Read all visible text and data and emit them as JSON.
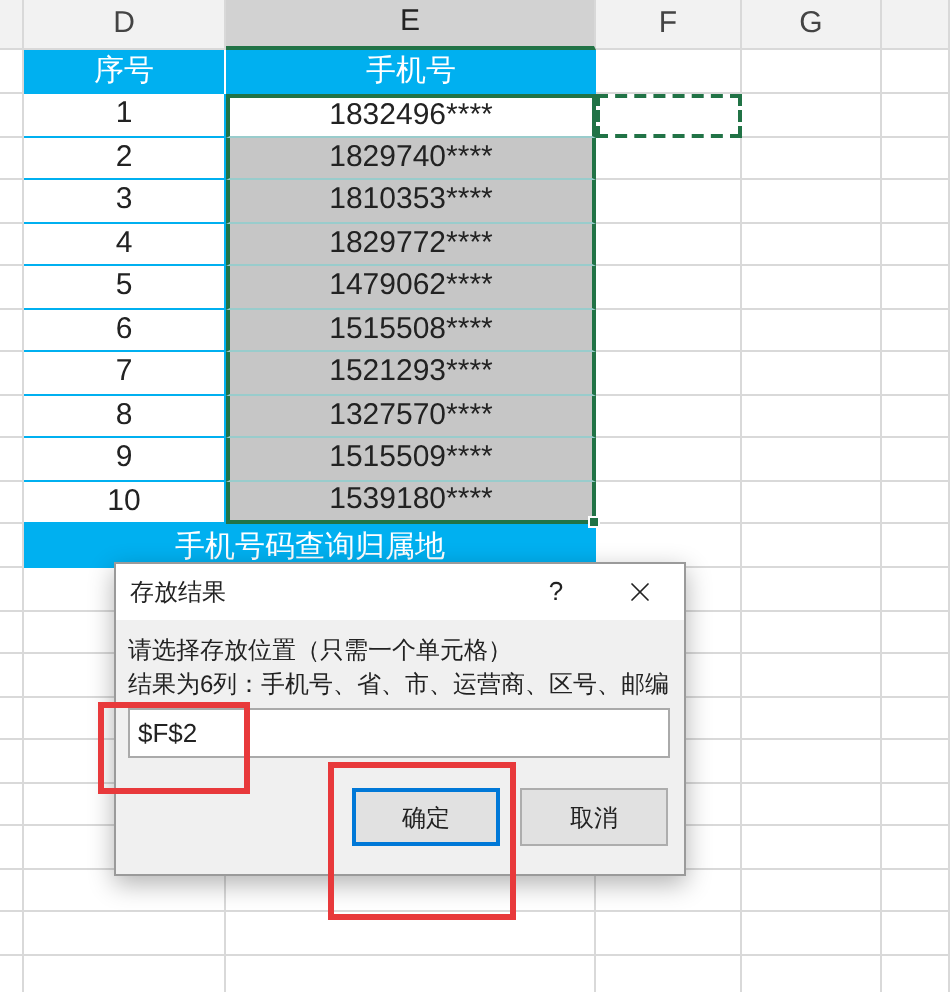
{
  "columns": [
    {
      "label": "D",
      "selected": false
    },
    {
      "label": "E",
      "selected": true
    },
    {
      "label": "F",
      "selected": false
    },
    {
      "label": "G",
      "selected": false
    }
  ],
  "table": {
    "headers": [
      "序号",
      "手机号"
    ],
    "rows": [
      {
        "index": "1",
        "phone": "1832496****",
        "highlighted": false
      },
      {
        "index": "2",
        "phone": "1829740****",
        "highlighted": true
      },
      {
        "index": "3",
        "phone": "1810353****",
        "highlighted": true
      },
      {
        "index": "4",
        "phone": "1829772****",
        "highlighted": true
      },
      {
        "index": "5",
        "phone": "1479062****",
        "highlighted": true
      },
      {
        "index": "6",
        "phone": "1515508****",
        "highlighted": true
      },
      {
        "index": "7",
        "phone": "1521293****",
        "highlighted": true
      },
      {
        "index": "8",
        "phone": "1327570****",
        "highlighted": true
      },
      {
        "index": "9",
        "phone": "1515509****",
        "highlighted": true
      },
      {
        "index": "10",
        "phone": "1539180****",
        "highlighted": true
      }
    ],
    "title": "手机号码查询归属地"
  },
  "dialog": {
    "title": "存放结果",
    "help": "?",
    "prompt": "请选择存放位置（只需一个单元格）",
    "note": "结果为6列：手机号、省、市、运营商、区号、邮编",
    "value": "$F$2",
    "buttons": [
      {
        "label": "确定",
        "focused": true
      },
      {
        "label": "取消",
        "focused": false
      }
    ]
  }
}
